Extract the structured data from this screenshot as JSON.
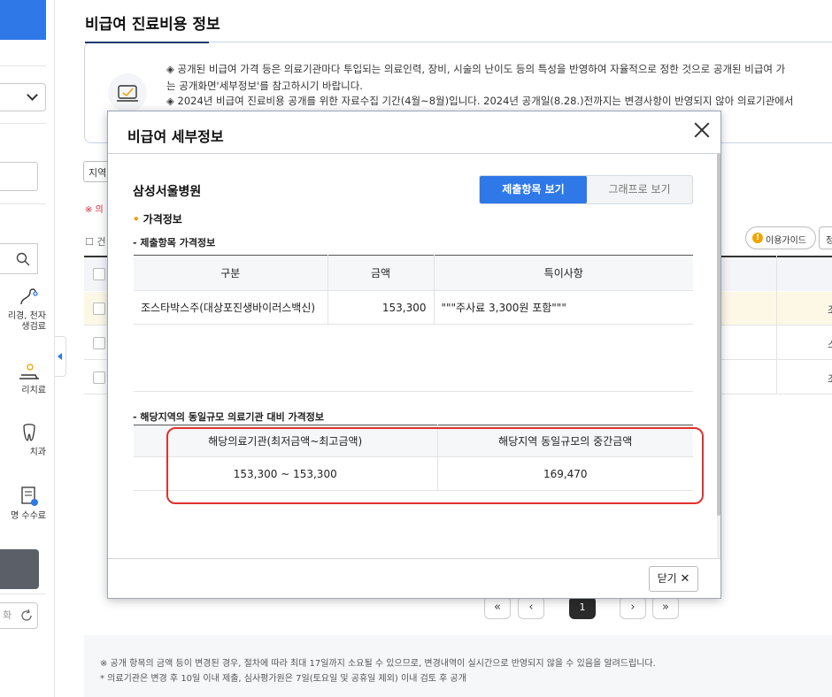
{
  "page": {
    "title": "비급여 진료비용 정보",
    "notice": [
      "◈ 공개된 비급여 가격 등은 의료기관마다 투입되는 의료인력, 장비, 시술의 난이도 등의 특성을 반영하여 자율적으로 정한 것으로 공개된 비급여 가",
      "는 공개화면'세부정보'를 참고하시기 바랍니다.",
      "◈ 2024년 비급여 진료비용 공개를 위한 자료수집 기간(4월~8월)입니다. 2024년 공개일(8.28.)전까지는 변경사항이 반영되지 않아 의료기관에서"
    ],
    "region_filter": "지역",
    "red_note": "※ 의",
    "list_label": "건",
    "guide_button": "이용가이드",
    "guide_button2": "정",
    "bg_rows": [
      "조",
      "스",
      "조"
    ],
    "pagination": {
      "first": "«",
      "prev": "‹",
      "current": "1",
      "next": "›",
      "last": "»"
    },
    "footer": [
      "※ 공개 항목의 금액 등이 변경된 경우, 절차에 따라 최대 17일까지 소요될 수 있으므로, 변경내역이 실시간으로 반영되지 않을 수 있음을 알려드립니다.",
      "* 의료기관은 변경 후 10일 이내 제출, 심사평가원은 7일(토요일 및 공휴일 제외) 이내 검토 후 공개"
    ]
  },
  "sidebar": {
    "categories": [
      {
        "label_line1": "리경, 천자",
        "label_line2": "생검료",
        "icon": "endoscope-icon"
      },
      {
        "label_line1": "리치료",
        "label_line2": "",
        "icon": "therapy-icon"
      },
      {
        "label_line1": "치과",
        "label_line2": "",
        "icon": "tooth-icon"
      },
      {
        "label_line1": "명 수수료",
        "label_line2": "",
        "icon": "certificate-icon"
      }
    ],
    "reset_label": "화"
  },
  "modal": {
    "title": "비급여 세부정보",
    "hospital": "삼성서울병원",
    "toggle": {
      "active": "제출항목 보기",
      "inactive": "그래프로 보기"
    },
    "section_price": "가격정보",
    "submitted_subtitle": "- 제출항목 가격정보",
    "table1": {
      "headers": [
        "구분",
        "금액",
        "특이사항"
      ],
      "rows": [
        {
          "category": "조스타박스주(대상포진생바이러스백신)",
          "amount": "153,300",
          "note": "\"\"\"주사료 3,300원 포함\"\"\""
        }
      ]
    },
    "compare_subtitle": "- 해당지역의 동일규모 의료기관 대비 가격정보",
    "table2": {
      "headers": [
        "해당의료기관(최저금액~최고금액)",
        "해당지역 동일규모의 중간금액"
      ],
      "row": {
        "range": "153,300 ~ 153,300",
        "median": "169,470"
      }
    },
    "close_label": "닫기",
    "close_x": "✕"
  },
  "colors": {
    "accent": "#2e78e8",
    "highlight_border": "#e0312d",
    "price_dot": "#f0a000"
  }
}
